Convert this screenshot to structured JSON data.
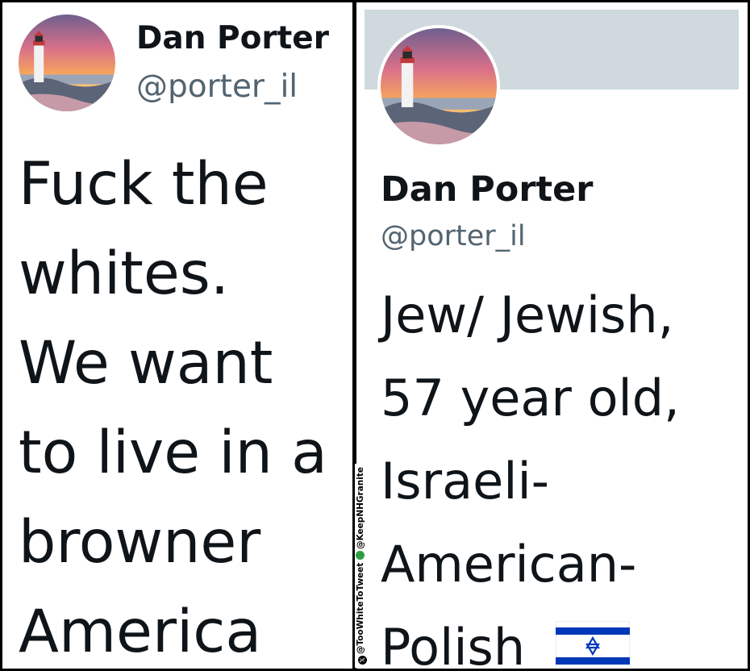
{
  "left_tweet": {
    "author": {
      "display_name": "Dan Porter",
      "handle": "@porter_il"
    },
    "text_lines": [
      "Fuck the",
      "whites.",
      "We want",
      "to live in a",
      "browner",
      "America"
    ]
  },
  "right_profile": {
    "display_name": "Dan Porter",
    "handle": "@porter_il",
    "bio_lines": [
      "Jew/ Jewish,",
      "57 year old,",
      "Israeli-",
      "American-",
      "Polish"
    ],
    "bio_flag": "israel-flag-icon",
    "banner_color": "#cfd9de"
  },
  "watermark": {
    "handle_1": "@TooWhiteToTweet",
    "handle_2": "@KeepNHGranite"
  },
  "colors": {
    "text": "#0f1419",
    "secondary_text": "#536471",
    "flag_blue": "#0038b8"
  }
}
